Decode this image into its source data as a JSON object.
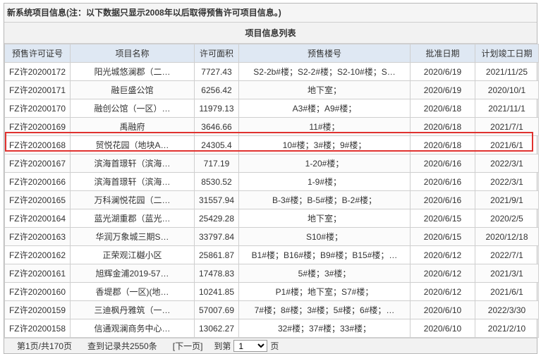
{
  "notice": "新系统项目信息(注：以下数据只显示2008年以后取得预售许可项目信息。)",
  "caption": "项目信息列表",
  "columns": [
    "预售许可证号",
    "项目名称",
    "许可面积",
    "预售楼号",
    "批准日期",
    "计划竣工日期"
  ],
  "rows": [
    {
      "license": "FZ许20200172",
      "name": "阳光城悠澜郡（二…",
      "area": "7727.43",
      "buildings": "S2-2b#楼；S2-2#楼；S2-10#楼；S…",
      "approved": "2020/6/19",
      "completion": "2021/11/25"
    },
    {
      "license": "FZ许20200171",
      "name": "融巨盛公馆",
      "area": "6256.42",
      "buildings": "地下室；",
      "approved": "2020/6/19",
      "completion": "2020/10/1"
    },
    {
      "license": "FZ许20200170",
      "name": "融创公馆（一区）…",
      "area": "11979.13",
      "buildings": "A3#楼；A9#楼；",
      "approved": "2020/6/18",
      "completion": "2021/11/1"
    },
    {
      "license": "FZ许20200169",
      "name": "禹融府",
      "area": "3646.66",
      "buildings": "11#楼；",
      "approved": "2020/6/18",
      "completion": "2021/7/1"
    },
    {
      "license": "FZ许20200168",
      "name": "贸悦花园（地块A…",
      "area": "24305.4",
      "buildings": "10#楼；3#楼；9#楼；",
      "approved": "2020/6/18",
      "completion": "2021/6/1"
    },
    {
      "license": "FZ许20200167",
      "name": "滨海首璟轩（滨海…",
      "area": "717.19",
      "buildings": "1-20#楼；",
      "approved": "2020/6/16",
      "completion": "2022/3/1"
    },
    {
      "license": "FZ许20200166",
      "name": "滨海首璟轩（滨海…",
      "area": "8530.52",
      "buildings": "1-9#楼；",
      "approved": "2020/6/16",
      "completion": "2022/3/1"
    },
    {
      "license": "FZ许20200165",
      "name": "万科澜悦花园（二…",
      "area": "31557.94",
      "buildings": "B-3#楼；B-5#楼；B-2#楼；",
      "approved": "2020/6/16",
      "completion": "2021/9/1"
    },
    {
      "license": "FZ许20200164",
      "name": "蓝光湖重郡（蓝光…",
      "area": "25429.28",
      "buildings": "地下室；",
      "approved": "2020/6/15",
      "completion": "2020/2/5"
    },
    {
      "license": "FZ许20200163",
      "name": "华润万象城三期S…",
      "area": "33797.84",
      "buildings": "S10#楼；",
      "approved": "2020/6/15",
      "completion": "2020/12/18"
    },
    {
      "license": "FZ许20200162",
      "name": "正荣观江樾小区",
      "area": "25861.87",
      "buildings": "B1#楼；B16#楼；B9#楼；B15#楼；…",
      "approved": "2020/6/12",
      "completion": "2022/7/1"
    },
    {
      "license": "FZ许20200161",
      "name": "旭辉金浦2019-57…",
      "area": "17478.83",
      "buildings": "5#楼；3#楼；",
      "approved": "2020/6/12",
      "completion": "2021/3/1"
    },
    {
      "license": "FZ许20200160",
      "name": "香堤郡（一区)(地…",
      "area": "10241.85",
      "buildings": "P1#楼；地下室；S7#楼；",
      "approved": "2020/6/12",
      "completion": "2021/6/1"
    },
    {
      "license": "FZ许20200159",
      "name": "三迪枫丹雅筑（一…",
      "area": "57007.69",
      "buildings": "7#楼；8#楼；3#楼；5#楼；6#楼；…",
      "approved": "2020/6/10",
      "completion": "2022/3/30"
    },
    {
      "license": "FZ许20200158",
      "name": "信通观澜商务中心…",
      "area": "13062.27",
      "buildings": "32#楼；37#楼；33#楼；",
      "approved": "2020/6/10",
      "completion": "2021/2/10"
    }
  ],
  "pager": {
    "page_info": "第1页/共170页",
    "record_info": "查到记录共2550条",
    "next_label": "[下一页]",
    "jump_label": "到第",
    "selected_page": "1",
    "page_suffix": "页"
  },
  "colors": {
    "header_bg": "#dfe8f3",
    "highlight_border": "#e0322f"
  }
}
